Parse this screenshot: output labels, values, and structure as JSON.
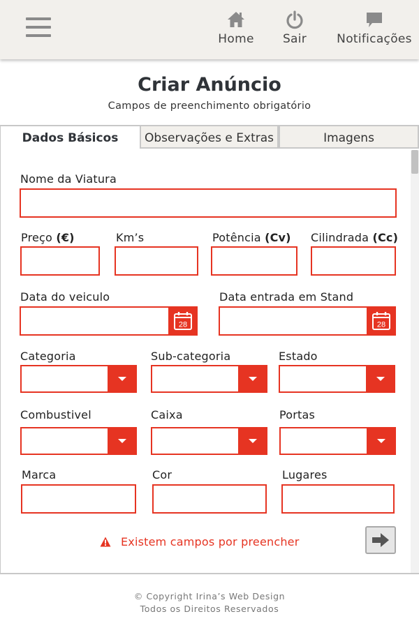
{
  "header": {
    "nav": {
      "home": "Home",
      "logout": "Sair",
      "notifications": "Notificações"
    }
  },
  "page": {
    "title": "Criar Anúncio",
    "subtitle": "Campos de preenchimento obrigatório"
  },
  "tabs": {
    "basic": "Dados Básicos",
    "observations": "Observações e Extras",
    "images": "Imagens"
  },
  "form": {
    "vehicle_name": {
      "label": "Nome da Viatura",
      "value": ""
    },
    "price": {
      "label": "Preço",
      "unit": "(€)",
      "value": ""
    },
    "km": {
      "label": "Km’s",
      "value": ""
    },
    "power": {
      "label": "Potência",
      "unit": "(Cv)",
      "value": ""
    },
    "displacement": {
      "label": "Cilindrada",
      "unit": "(Cc)",
      "value": ""
    },
    "vehicle_date": {
      "label": "Data do veiculo",
      "value": "",
      "calendar_day": "28"
    },
    "stand_date": {
      "label": "Data entrada em Stand",
      "value": "",
      "calendar_day": "28"
    },
    "category": {
      "label": "Categoria",
      "value": ""
    },
    "subcategory": {
      "label": "Sub-categoria",
      "value": ""
    },
    "state": {
      "label": "Estado",
      "value": ""
    },
    "fuel": {
      "label": "Combustivel",
      "value": ""
    },
    "gearbox": {
      "label": "Caixa",
      "value": ""
    },
    "doors": {
      "label": "Portas",
      "value": ""
    },
    "brand": {
      "label": "Marca",
      "value": ""
    },
    "color": {
      "label": "Cor",
      "value": ""
    },
    "seats": {
      "label": "Lugares",
      "value": ""
    }
  },
  "validation": {
    "message": "Existem campos por preencher"
  },
  "footer": {
    "copyright": "© Copyright Irina’s Web Design",
    "rights": "Todos os Direitos Reservados"
  },
  "colors": {
    "accent": "#e63422",
    "header_bg": "#f2f0ec",
    "icon_gray": "#8a8a8a"
  }
}
